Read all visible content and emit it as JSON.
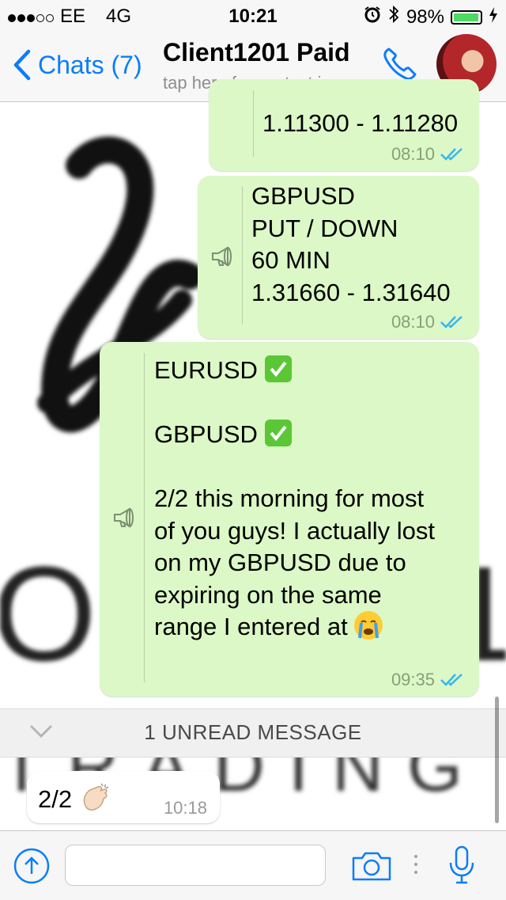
{
  "status_bar": {
    "carrier": "EE",
    "network": "4G",
    "time": "10:21",
    "battery": "98%",
    "battery_level": 0.98
  },
  "nav": {
    "back_label": "Chats (7)",
    "contact_name": "Client1201 Paid",
    "contact_subtitle": "tap here for contact in",
    "accent": "#0a7dfb"
  },
  "messages": [
    {
      "lines": [
        "1.11300 - 1.11280"
      ],
      "time": "08:10"
    },
    {
      "lines": [
        "GBPUSD",
        "PUT / DOWN",
        "60 MIN",
        "1.31660 - 1.31640"
      ],
      "time": "08:10"
    },
    {
      "lines": [
        "EURUSD",
        "",
        "GBPUSD",
        "",
        "2/2 this morning for most",
        "of you guys! I actually lost",
        "on my GBPUSD due to",
        "expiring on the same",
        "range I entered at"
      ],
      "time": "09:35"
    }
  ],
  "unread_label": "1 UNREAD MESSAGE",
  "incoming": {
    "text": "2/2",
    "time": "10:18"
  },
  "colors": {
    "outgoing_bubble": "#dcf8c6",
    "incoming_bubble": "#ffffff",
    "read_ticks": "#34b7f1"
  },
  "icons": [
    "back-chevron-icon",
    "phone-icon",
    "megaphone-icon",
    "double-tick-icon",
    "upload-arrow-icon",
    "camera-icon",
    "microphone-icon",
    "alarm-icon",
    "bluetooth-icon",
    "chevron-down-icon"
  ]
}
